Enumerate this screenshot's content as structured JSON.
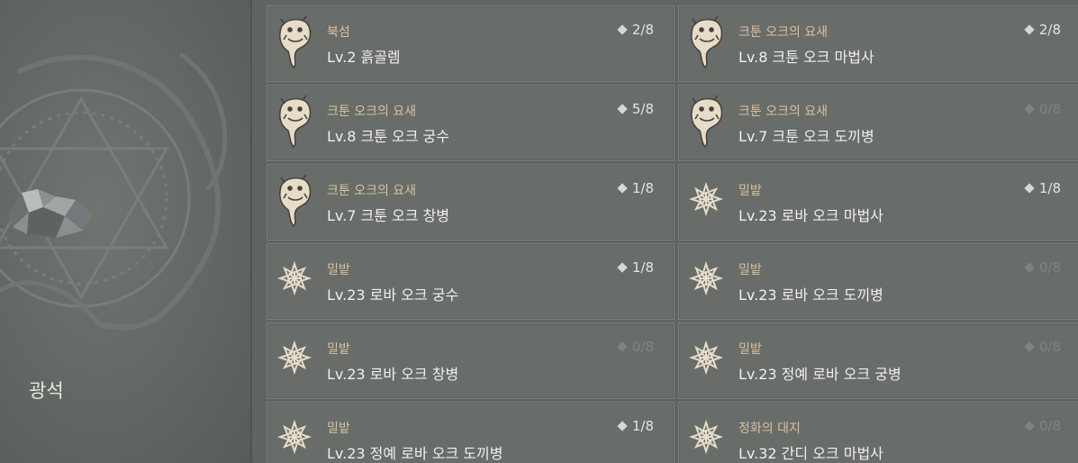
{
  "category": {
    "title": "광석"
  },
  "entries": [
    {
      "location": "북섬",
      "monster": "Lv.2 흙골렘",
      "count": "2/8",
      "icon": "boar-icon",
      "dim": false
    },
    {
      "location": "크툰 오크의 요새",
      "monster": "Lv.8 크툰 오크 마법사",
      "count": "2/8",
      "icon": "boar-icon",
      "dim": false
    },
    {
      "location": "크툰 오크의 요새",
      "monster": "Lv.8 크툰 오크 궁수",
      "count": "5/8",
      "icon": "boar-icon",
      "dim": false
    },
    {
      "location": "크툰 오크의 요새",
      "monster": "Lv.7 크툰 오크 도끼병",
      "count": "0/8",
      "icon": "boar-icon",
      "dim": true
    },
    {
      "location": "크툰 오크의 요새",
      "monster": "Lv.7 크툰 오크 창병",
      "count": "1/8",
      "icon": "boar-icon",
      "dim": false
    },
    {
      "location": "밀밭",
      "monster": "Lv.23 로바 오크 마법사",
      "count": "1/8",
      "icon": "star-emblem-icon",
      "dim": false
    },
    {
      "location": "밀밭",
      "monster": "Lv.23 로바 오크 궁수",
      "count": "1/8",
      "icon": "star-emblem-icon",
      "dim": false
    },
    {
      "location": "밀밭",
      "monster": "Lv.23 로바 오크 도끼병",
      "count": "0/8",
      "icon": "star-emblem-icon",
      "dim": true
    },
    {
      "location": "밀밭",
      "monster": "Lv.23 로바 오크 창병",
      "count": "0/8",
      "icon": "star-emblem-icon",
      "dim": true
    },
    {
      "location": "밀밭",
      "monster": "Lv.23 정예 로바 오크 궁병",
      "count": "0/8",
      "icon": "star-emblem-icon",
      "dim": true
    },
    {
      "location": "밀밭",
      "monster": "Lv.23 정예 로바 오크 도끼병",
      "count": "1/8",
      "icon": "star-emblem-icon",
      "dim": false
    },
    {
      "location": "정화의 대지",
      "monster": "Lv.32 간디 오크 마법사",
      "count": "0/8",
      "icon": "star-emblem-icon",
      "dim": true
    }
  ]
}
